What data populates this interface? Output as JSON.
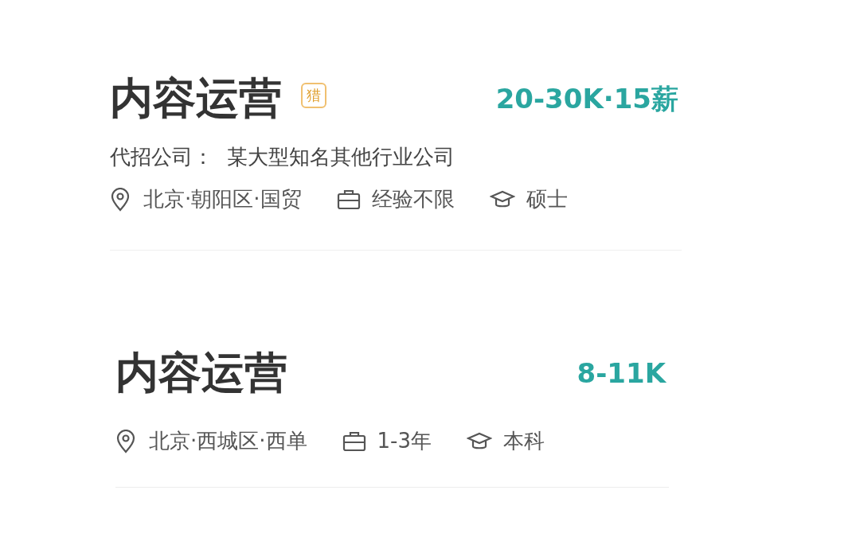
{
  "jobs": [
    {
      "title": "内容运营",
      "badge": "猎",
      "salary": "20-30K·15薪",
      "company": "代招公司：  某大型知名其他行业公司",
      "location": "北京·朝阳区·国贸",
      "experience": "经验不限",
      "education": "硕士"
    },
    {
      "title": "内容运营",
      "salary": "8-11K",
      "location": "北京·西城区·西单",
      "experience": "1-3年",
      "education": "本科"
    }
  ]
}
